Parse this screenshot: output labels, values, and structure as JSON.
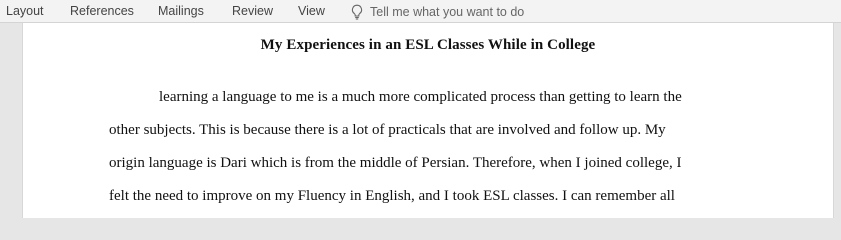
{
  "ribbon": {
    "tabs": [
      "Layout",
      "References",
      "Mailings",
      "Review",
      "View"
    ],
    "tell_me": "Tell me what you want to do",
    "tell_me_icon": "lightbulb-icon"
  },
  "document": {
    "title": "My Experiences in an ESL Classes While in College",
    "lines": [
      "learning a language to me is a much more complicated process than getting to learn the",
      "other subjects. This is because there is a lot of practicals that are involved and follow up. My",
      "origin language is Dari which is from the middle of Persian. Therefore, when I joined college, I",
      "felt the need to improve on my Fluency in English, and I took ESL classes. I can remember all"
    ]
  }
}
